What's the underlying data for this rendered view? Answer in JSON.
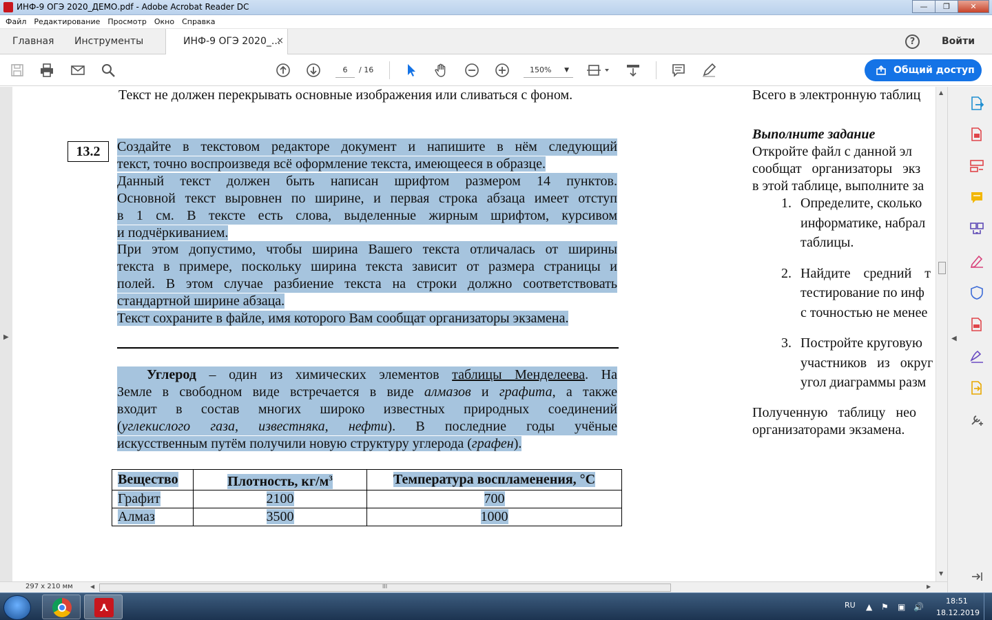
{
  "window": {
    "title": "ИНФ-9 ОГЭ 2020_ДЕМО.pdf - Adobe Acrobat Reader DC",
    "minimize": "—",
    "maximize": "❐",
    "close": "✕"
  },
  "menu": [
    "Файл",
    "Редактирование",
    "Просмотр",
    "Окно",
    "Справка"
  ],
  "tabs": {
    "home": "Главная",
    "tools": "Инструменты",
    "doc": "ИНФ-9 ОГЭ 2020_...",
    "close": "×",
    "help": "?",
    "signin": "Войти"
  },
  "toolbar": {
    "page_current": "6",
    "page_total": "/ 16",
    "zoom": "150%",
    "zoom_caret": "▼",
    "share": "Общий доступ"
  },
  "doc": {
    "top_line": "Текст не должен перекрывать основные изображения или сливаться с фоном.",
    "task_number": "13.2",
    "task_para1": [
      "Создайте в текстовом редакторе документ и напишите в нём следующий",
      "текст, точно воспроизведя всё оформление текста, имеющееся в образце."
    ],
    "task_para2": [
      "Данный текст должен быть написан шрифтом размером 14 пунктов.",
      "Основной текст выровнен по ширине, и первая строка абзаца имеет отступ",
      "в 1 см. В тексте есть слова, выделенные жирным шрифтом, курсивом",
      "и подчёркиванием."
    ],
    "task_para3": [
      "При этом допустимо, чтобы ширина Вашего текста отличалась от ширины",
      "текста в примере, поскольку ширина текста зависит от размера страницы и",
      "полей. В этом случае разбиение текста на строки должно соответствовать",
      "стандартной ширине абзаца."
    ],
    "task_para4": "Текст сохраните в файле, имя которого Вам сообщат организаторы экзамена.",
    "sample": {
      "bold_word": "Углерод",
      "l1_rest": " – один из химических элементов ",
      "underlined": "таблицы Менделеева",
      "l1_end": ". На",
      "l2_a": "Земле в свободном виде встречается в виде ",
      "l2_i1": "алмазов",
      "l2_b": " и ",
      "l2_i2": "графита",
      "l2_c": ", а также",
      "l3": "входит в состав многих широко известных природных соединений",
      "l4_open": "(",
      "l4_i1": "углекислого газа",
      "l4_sep1": ", ",
      "l4_i2": "известняка",
      "l4_sep2": ", ",
      "l4_i3": "нефти",
      "l4_rest": "). В последние годы учёные",
      "l5_a": "искусственным путём получили новую структуру углерода (",
      "l5_i": "графен",
      "l5_b": ")."
    },
    "table": {
      "headers": [
        "Вещество",
        "Плотность, кг/м",
        "Температура воспламенения, °С"
      ],
      "header_sup": "3",
      "rows": [
        [
          "Графит",
          "2100",
          "700"
        ],
        [
          "Алмаз",
          "3500",
          "1000"
        ]
      ]
    },
    "right_column": {
      "l1": "Всего в электронную таблиц",
      "heading": "Выполните задание",
      "l2": " Откройте файл с данной эл",
      "l3": "сообщат организаторы экз",
      "l4": "в этой таблице, выполните за",
      "items": [
        {
          "num": "1.",
          "lines": [
            "Определите, сколько",
            "информатике, набрал",
            "таблицы."
          ]
        },
        {
          "num": "2.",
          "lines": [
            "Найдите средний т",
            "тестирование по инф",
            "с точностью не менее"
          ]
        },
        {
          "num": "3.",
          "lines": [
            "Постройте круговую",
            "участников из округ",
            "угол диаграммы разм"
          ]
        }
      ],
      "f1": "Полученную таблицу нео",
      "f2": "организаторами экзамена."
    }
  },
  "status": {
    "page_size": "297 x 210 мм",
    "grip": "III"
  },
  "taskbar": {
    "lang": "RU",
    "time": "18:51",
    "date": "18.12.2019"
  },
  "colors": {
    "selection_highlight": "#a6c4de",
    "share_button": "#1473e6",
    "acrobat_red": "#c8161d"
  }
}
